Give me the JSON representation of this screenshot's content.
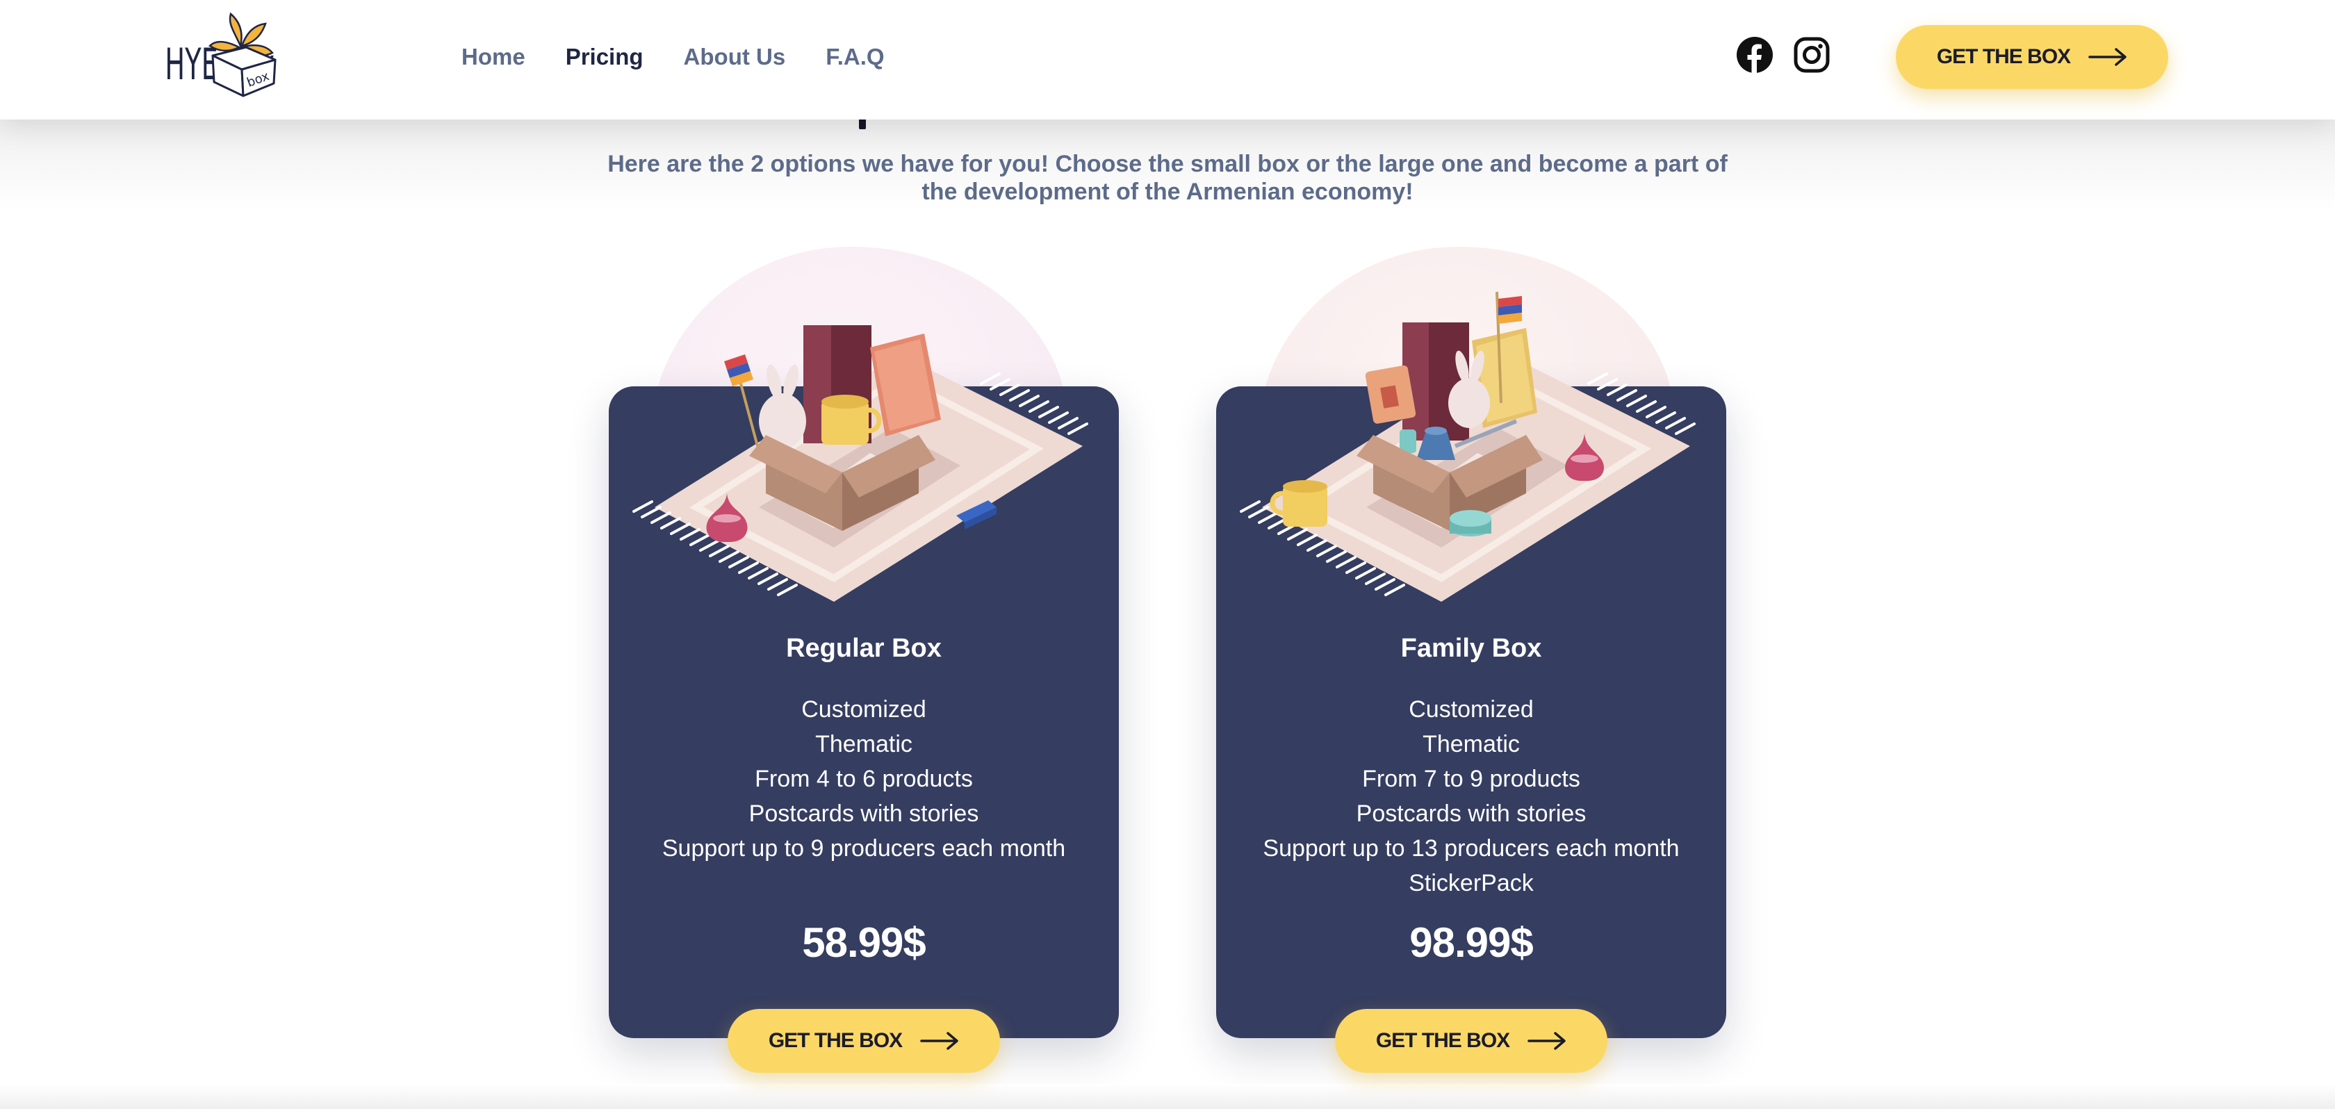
{
  "header": {
    "logo_text": "HYE box",
    "nav": [
      {
        "label": "Home",
        "active": false
      },
      {
        "label": "Pricing",
        "active": true
      },
      {
        "label": "About Us",
        "active": false
      },
      {
        "label": "F.A.Q",
        "active": false
      }
    ],
    "social": [
      "facebook-icon",
      "instagram-icon"
    ],
    "cta_label": "GET THE BOX"
  },
  "intro": {
    "line1": "Here are the 2 options we have for you! Choose the small box or the large one and become a part of",
    "line2": "the development of the Armenian economy!"
  },
  "plans": [
    {
      "title": "Regular Box",
      "features": [
        "Customized",
        "Thematic",
        "From 4 to 6 products",
        "Postcards with stories",
        "Support up to 9 producers each month"
      ],
      "price": "58.99$",
      "cta_label": "GET THE BOX"
    },
    {
      "title": "Family Box",
      "features": [
        "Customized",
        "Thematic",
        "From 7 to 9 products",
        "Postcards with stories",
        "Support up to 13 producers each month",
        "StickerPack"
      ],
      "price": "98.99$",
      "cta_label": "GET THE BOX"
    }
  ],
  "colors": {
    "card": "#353d60",
    "accent": "#fbd866",
    "nav_text": "#5d6b8a",
    "nav_active": "#1f2545"
  }
}
